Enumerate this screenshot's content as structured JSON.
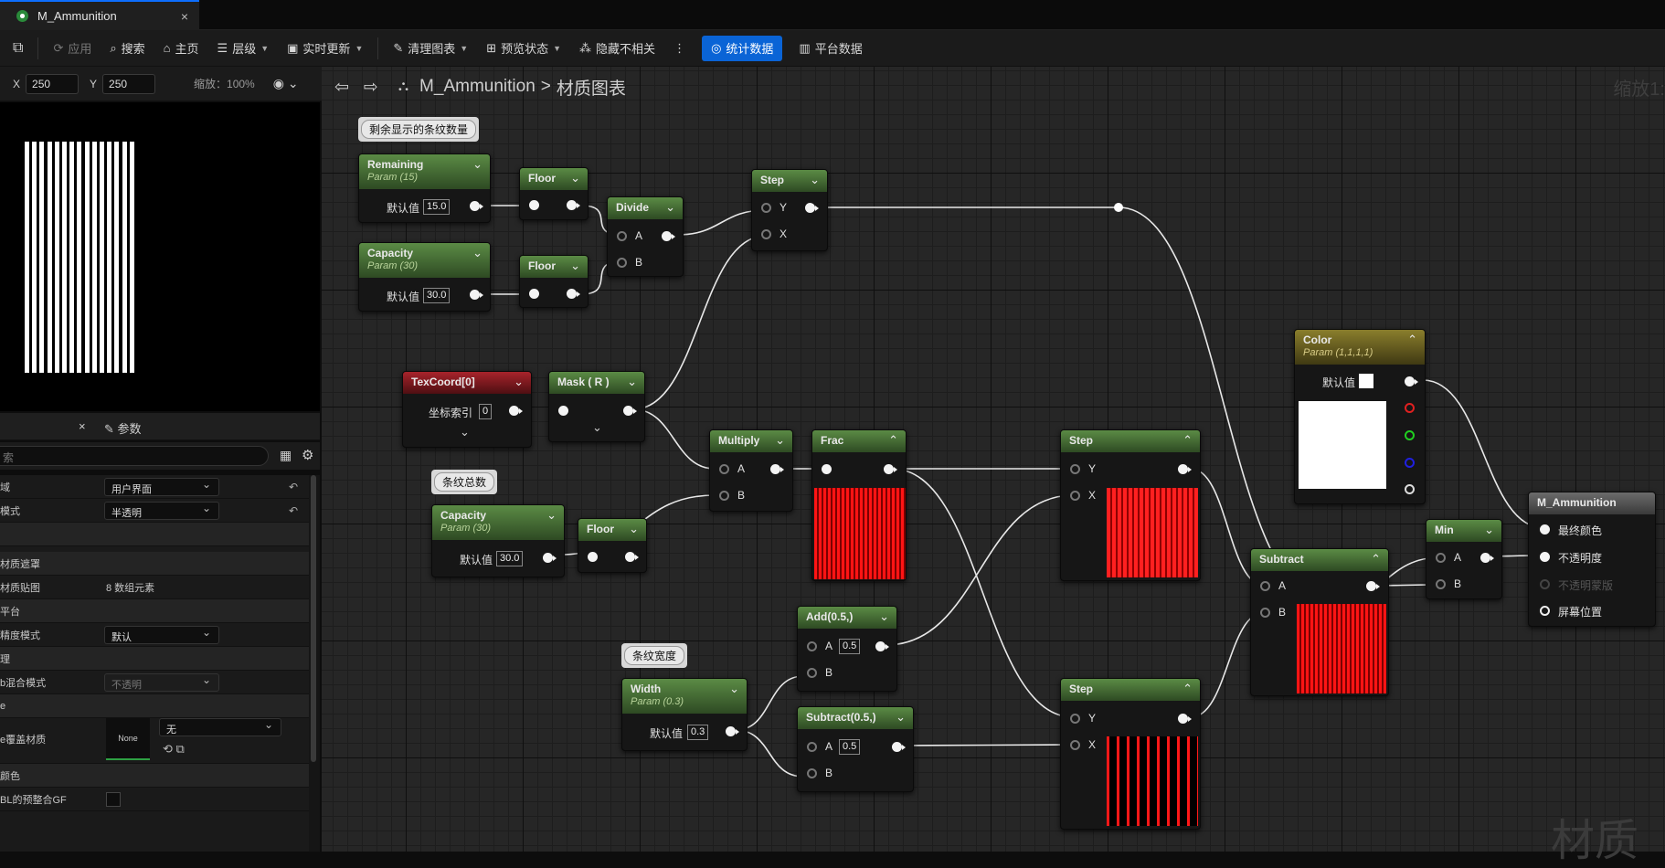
{
  "tab": {
    "title": "M_Ammunition",
    "close": "×"
  },
  "toolbar": {
    "apply": "应用",
    "search": "搜索",
    "home": "主页",
    "hierarchy": "层级",
    "live_update": "实时更新",
    "clean_graph": "清理图表",
    "preview_state": "预览状态",
    "hide_unrelated": "隐藏不相关",
    "stats": "统计数据",
    "platform_stats": "平台数据"
  },
  "viewport": {
    "x_label": "X",
    "x_value": "250",
    "y_label": "Y",
    "y_value": "250",
    "zoom": "缩放：100%"
  },
  "details": {
    "close": "×",
    "params_tab": "参数",
    "search_placeholder": "索"
  },
  "properties": [
    {
      "label": "域",
      "value": "用户界面",
      "kind": "dropdown",
      "reset": true
    },
    {
      "label": "模式",
      "value": "半透明",
      "kind": "dropdown",
      "reset": true
    },
    {
      "label": "",
      "value": "",
      "kind": "category"
    },
    {
      "label": "材质遮罩",
      "value": "",
      "kind": "plain"
    },
    {
      "label": "材质贴图",
      "value": "8 数组元素",
      "kind": "text"
    },
    {
      "label": "平台",
      "value": "",
      "kind": "plain"
    },
    {
      "label": "精度模式",
      "value": "默认",
      "kind": "dropdown"
    },
    {
      "label": "理",
      "value": "",
      "kind": "plain"
    },
    {
      "label": "b混合模式",
      "value": "不透明",
      "kind": "dropdown-dim"
    },
    {
      "label": "e",
      "value": "",
      "kind": "plain"
    },
    {
      "label": "e覆盖材质",
      "value": "无",
      "kind": "asset",
      "thumb": "None"
    },
    {
      "label": "颜色",
      "value": "",
      "kind": "plain"
    },
    {
      "label": "BL的预整合GF",
      "value": "",
      "kind": "checkbox"
    }
  ],
  "breadcrumb": {
    "asset": "M_Ammunition",
    "sep": ">",
    "graph": "材质图表",
    "zoom": "缩放1:"
  },
  "comments": {
    "remaining": "剩余显示的条纹数量",
    "total": "条纹总数",
    "width": "条纹宽度"
  },
  "nodes": {
    "remaining": {
      "title": "Remaining",
      "sub": "Param (15)",
      "label": "默认值",
      "value": "15.0"
    },
    "capacity1": {
      "title": "Capacity",
      "sub": "Param (30)",
      "label": "默认值",
      "value": "30.0"
    },
    "floor1": {
      "title": "Floor"
    },
    "floor2": {
      "title": "Floor"
    },
    "divide": {
      "title": "Divide",
      "a": "A",
      "b": "B"
    },
    "step1": {
      "title": "Step",
      "y": "Y",
      "x": "X"
    },
    "texcoord": {
      "title": "TexCoord[0]",
      "label": "坐标索引",
      "value": "0"
    },
    "mask": {
      "title": "Mask ( R )"
    },
    "multiply": {
      "title": "Multiply",
      "a": "A",
      "b": "B"
    },
    "frac": {
      "title": "Frac"
    },
    "capacity2": {
      "title": "Capacity",
      "sub": "Param (30)",
      "label": "默认值",
      "value": "30.0"
    },
    "floor3": {
      "title": "Floor"
    },
    "step2": {
      "title": "Step",
      "y": "Y",
      "x": "X"
    },
    "color": {
      "title": "Color",
      "sub": "Param (1,1,1,1)",
      "label": "默认值"
    },
    "subtract": {
      "title": "Subtract",
      "a": "A",
      "b": "B"
    },
    "min": {
      "title": "Min",
      "a": "A",
      "b": "B"
    },
    "output": {
      "title": "M_Ammunition",
      "final_color": "最终颜色",
      "opacity": "不透明度",
      "opacity_mask": "不透明蒙版",
      "screen_pos": "屏幕位置"
    },
    "add": {
      "title": "Add(0.5,)",
      "a": "A",
      "a_value": "0.5",
      "b": "B"
    },
    "width": {
      "title": "Width",
      "sub": "Param (0.3)",
      "label": "默认值",
      "value": "0.3"
    },
    "subtract05": {
      "title": "Subtract(0.5,)",
      "a": "A",
      "a_value": "0.5",
      "b": "B"
    },
    "step3": {
      "title": "Step",
      "y": "Y",
      "x": "X"
    }
  },
  "watermark": "材质",
  "colors": {
    "accent": "#0a64d6",
    "param_header": "#5b8b45",
    "texcoord_header": "#a8232b",
    "color_header": "#8a7e2c"
  }
}
